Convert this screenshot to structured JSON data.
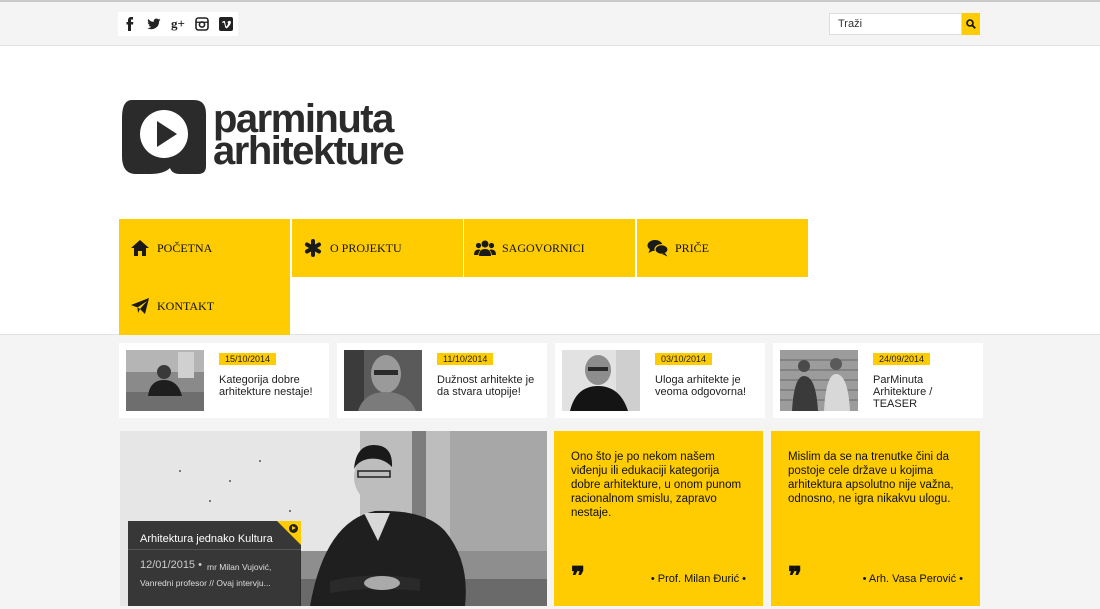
{
  "social": {
    "icons": [
      "facebook-icon",
      "twitter-icon",
      "google-plus-icon",
      "instagram-icon",
      "vimeo-icon"
    ],
    "labels": [
      "f",
      "t",
      "g+",
      "ig",
      "v"
    ]
  },
  "search": {
    "placeholder": "Traži"
  },
  "logo": {
    "line1": "parminuta",
    "line2": "arhitekture"
  },
  "nav": [
    {
      "label": "POČETNA",
      "icon": "home-icon"
    },
    {
      "label": "O PROJEKTU",
      "icon": "asterisk-icon"
    },
    {
      "label": "SAGOVORNICI",
      "icon": "users-icon"
    },
    {
      "label": "PRIČE",
      "icon": "comments-icon"
    },
    {
      "label": "KONTAKT",
      "icon": "paper-plane-icon"
    }
  ],
  "posts": [
    {
      "date": "15/10/2014",
      "title": "Kategorija dobre arhitekture nestaje!"
    },
    {
      "date": "11/10/2014",
      "title": "Dužnost arhitekte je da stvara utopije!"
    },
    {
      "date": "03/10/2014",
      "title": "Uloga arhitekte je veoma odgovorna!"
    },
    {
      "date": "24/09/2014",
      "title": "ParMinuta Arhitekture / TEASER"
    }
  ],
  "feature": {
    "title": "Arhitektura jednako Kultura",
    "date": "12/01/2015 •",
    "author": "mr Milan Vujović,",
    "excerpt": "Vanredni profesor  // Ovaj intervju..."
  },
  "quotes": [
    {
      "text": "Ono što je po nekom našem viđenju ili edukaciji kategorija dobre arhitekture, u onom punom racionalnom smislu, zapravo nestaje.",
      "author": "• Prof. Milan Đurić •"
    },
    {
      "text": "Mislim da se na trenutke čini da postoje cele države u kojima arhitektura apsolutno nije važna, odnosno, ne igra nikakvu ulogu.",
      "author": "• Arh. Vasa Perović •"
    }
  ],
  "colors": {
    "accent": "#fecc00",
    "dark": "#2b2b2b"
  }
}
